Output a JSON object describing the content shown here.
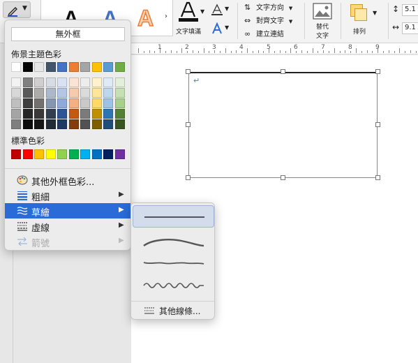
{
  "ribbon": {
    "wordart_sample": "A",
    "text_fill_label": "文字填滿",
    "text_direction_label": "文字方向",
    "align_text_label": "對齊文字",
    "create_link_label": "建立連結",
    "alt_text_label_line1": "替代",
    "alt_text_label_line2": "文字",
    "arrange_label": "排列",
    "height_value": "5.1",
    "width_value": "9.1"
  },
  "ruler": {
    "numbers": [
      "1",
      "2",
      "3",
      "4",
      "5",
      "6",
      "7",
      "8",
      "9"
    ]
  },
  "menu": {
    "no_outline": "無外框",
    "theme_colors_title": "佈景主題色彩",
    "standard_colors_title": "標準色彩",
    "more_colors": "其他外框色彩...",
    "weight": "粗細",
    "sketched": "草繪",
    "dashes": "虛線",
    "arrows": "箭號"
  },
  "submenu": {
    "more_lines": "其他線條..."
  },
  "colors": {
    "theme_top": [
      "#ffffff",
      "#000000",
      "#e7e6e6",
      "#44546a",
      "#4472c4",
      "#ed7d31",
      "#a5a5a5",
      "#ffc000",
      "#5b9bd5",
      "#70ad47"
    ],
    "theme_shades": [
      [
        "#f2f2f2",
        "#7f7f7f",
        "#d0cece",
        "#d6dce4",
        "#d9e2f3",
        "#fbe4d5",
        "#ededed",
        "#fff2cc",
        "#deebf6",
        "#e2efd9"
      ],
      [
        "#d8d8d8",
        "#595959",
        "#aeabab",
        "#adb9ca",
        "#b4c6e7",
        "#f7caac",
        "#dbdbdb",
        "#fee599",
        "#bdd7ee",
        "#c5e0b3"
      ],
      [
        "#bfbfbf",
        "#3f3f3f",
        "#757070",
        "#8496b0",
        "#8eaadb",
        "#f4b083",
        "#c9c9c9",
        "#ffd965",
        "#9cc3e5",
        "#a8d08d"
      ],
      [
        "#a5a5a5",
        "#262626",
        "#3a3838",
        "#323f4f",
        "#2f5496",
        "#c45911",
        "#7b7b7b",
        "#bf9000",
        "#2e75b5",
        "#538135"
      ],
      [
        "#7f7f7f",
        "#0c0c0c",
        "#171616",
        "#222a35",
        "#1f3864",
        "#833c0b",
        "#525252",
        "#7f6000",
        "#1e4e79",
        "#375623"
      ]
    ],
    "standard": [
      "#c00000",
      "#ff0000",
      "#ffc000",
      "#ffff00",
      "#92d050",
      "#00b050",
      "#00b0f0",
      "#0070c0",
      "#002060",
      "#7030a0"
    ]
  }
}
